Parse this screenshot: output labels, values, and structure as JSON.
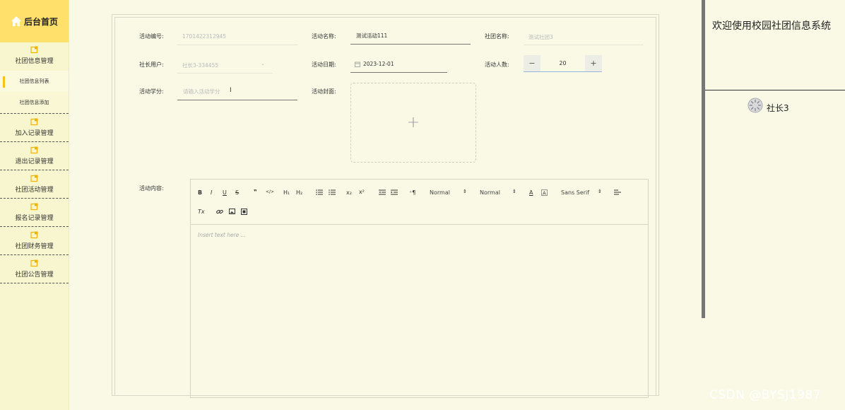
{
  "sidebar": {
    "brand": "后台首页",
    "groups": [
      {
        "label": "社团信息管理",
        "items": [
          "社团信息列表",
          "社团信息添加"
        ]
      },
      {
        "label": "加入记录管理"
      },
      {
        "label": "退出记录管理"
      },
      {
        "label": "社团活动管理"
      },
      {
        "label": "报名记录管理"
      },
      {
        "label": "社团财务管理"
      },
      {
        "label": "社团公告管理"
      }
    ]
  },
  "form": {
    "activity_no": {
      "label": "活动编号:",
      "value": "1701422312945"
    },
    "activity_name": {
      "label": "活动名称:",
      "value": "测试活动111"
    },
    "club_name": {
      "label": "社团名称:",
      "value": "测试社团3"
    },
    "leader_user": {
      "label": "社长用户:",
      "value": "社长3-334455"
    },
    "activity_date": {
      "label": "活动日期:",
      "value": "2023-12-01"
    },
    "participants": {
      "label": "活动人数:",
      "value": "20",
      "minus": "−",
      "plus": "+"
    },
    "credits": {
      "label": "活动学分:",
      "placeholder": "请输入活动学分"
    },
    "cover": {
      "label": "活动封面:",
      "plus": "+"
    },
    "content": {
      "label": "活动内容:",
      "placeholder": "Insert text here ..."
    }
  },
  "editor_toolbar": {
    "bold": "B",
    "italic": "I",
    "underline": "U",
    "strike": "S",
    "quote": "❞",
    "code": "</>",
    "h1": "H₁",
    "h2": "H₂",
    "sub": "x₂",
    "sup": "x²",
    "rtl": "⁺¶",
    "size1": "Normal",
    "size2": "Normal",
    "font": "Sans Serif",
    "color": "A",
    "clean": "Tx"
  },
  "header": {
    "welcome": "欢迎使用校园社团信息系统",
    "user": "社长3"
  },
  "watermark": "CSDN @BYSJ1987"
}
